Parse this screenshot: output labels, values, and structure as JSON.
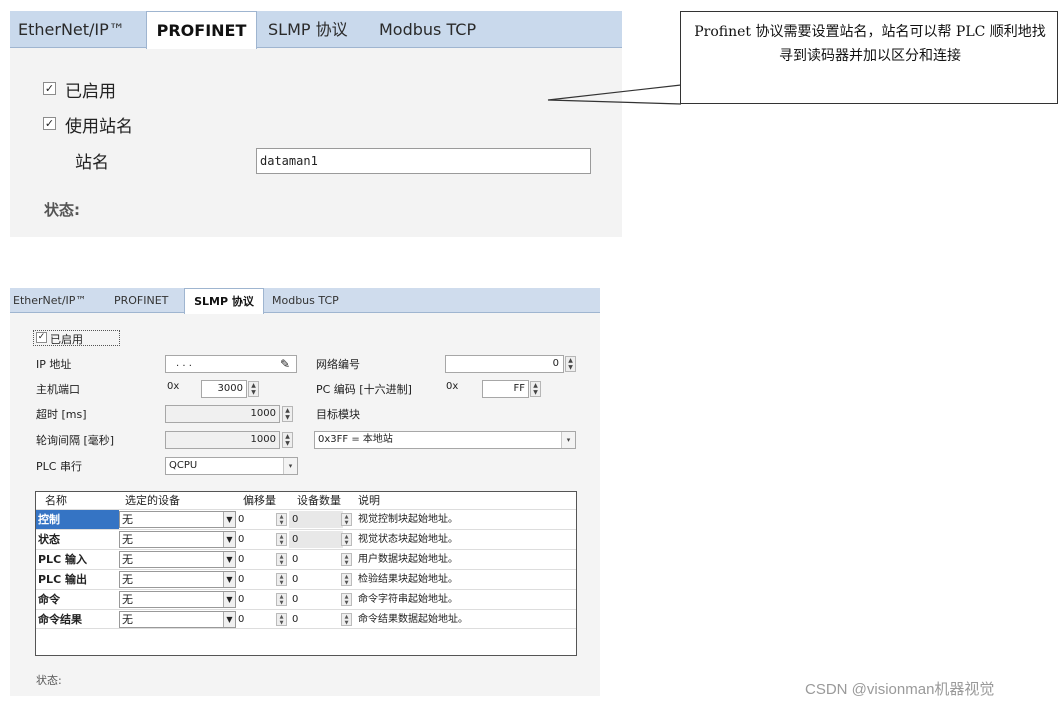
{
  "panel1": {
    "tabs": [
      "EtherNet/IP™",
      "PROFINET",
      "SLMP 协议",
      "Modbus TCP"
    ],
    "selected_tab": "PROFINET",
    "enabled_label": "已启用",
    "enabled_checked": true,
    "use_station_label": "使用站名",
    "use_station_checked": true,
    "station_label": "站名",
    "station_value": "dataman1",
    "status_label": "状态:"
  },
  "callout": {
    "text": "Profinet 协议需要设置站名，站名可以帮 PLC 顺利地找寻到读码器并加以区分和连接"
  },
  "panel2": {
    "tabs": [
      "EtherNet/IP™",
      "PROFINET",
      "SLMP 协议",
      "Modbus TCP"
    ],
    "selected_tab": "SLMP 协议",
    "enabled_label": "已启用",
    "enabled_checked": true,
    "ip_label": "IP 地址",
    "ip_value": ".   .   .",
    "network_label": "网络编号",
    "network_value": "0",
    "host_port_label": "主机端口",
    "host_port_prefix": "0x",
    "host_port_value": "3000",
    "pc_code_label": "PC 编码 [十六进制]",
    "pc_code_prefix": "0x",
    "pc_code_value": "FF",
    "timeout_label": "超时 [ms]",
    "timeout_value": "1000",
    "target_label": "目标模块",
    "poll_label": "轮询间隔 [毫秒]",
    "poll_value": "1000",
    "target_value": "0x3FF = 本地站",
    "plc_label": "PLC 串行",
    "plc_value": "QCPU",
    "table": {
      "headers": [
        "名称",
        "选定的设备",
        "偏移量",
        "设备数量",
        "说明"
      ],
      "rows": [
        {
          "name": "控制",
          "device": "无",
          "offset": "0",
          "count": "0",
          "desc": "视觉控制块起始地址。"
        },
        {
          "name": "状态",
          "device": "无",
          "offset": "0",
          "count": "0",
          "desc": "视觉状态块起始地址。"
        },
        {
          "name": "PLC 输入",
          "device": "无",
          "offset": "0",
          "count": "0",
          "desc": "用户数据块起始地址。"
        },
        {
          "name": "PLC 输出",
          "device": "无",
          "offset": "0",
          "count": "0",
          "desc": "检验结果块起始地址。"
        },
        {
          "name": "命令",
          "device": "无",
          "offset": "0",
          "count": "0",
          "desc": "命令字符串起始地址。"
        },
        {
          "name": "命令结果",
          "device": "无",
          "offset": "0",
          "count": "0",
          "desc": "命令结果数据起始地址。"
        }
      ]
    },
    "status_label": "状态:"
  },
  "watermark": "CSDN @visionman机器视觉",
  "colors": {
    "tab_bar": "#c9d9ec",
    "selection": "#3574c4"
  },
  "icons": [
    "checkbox-icon",
    "pencil-icon",
    "spinner-icon",
    "dropdown-arrow-icon"
  ]
}
